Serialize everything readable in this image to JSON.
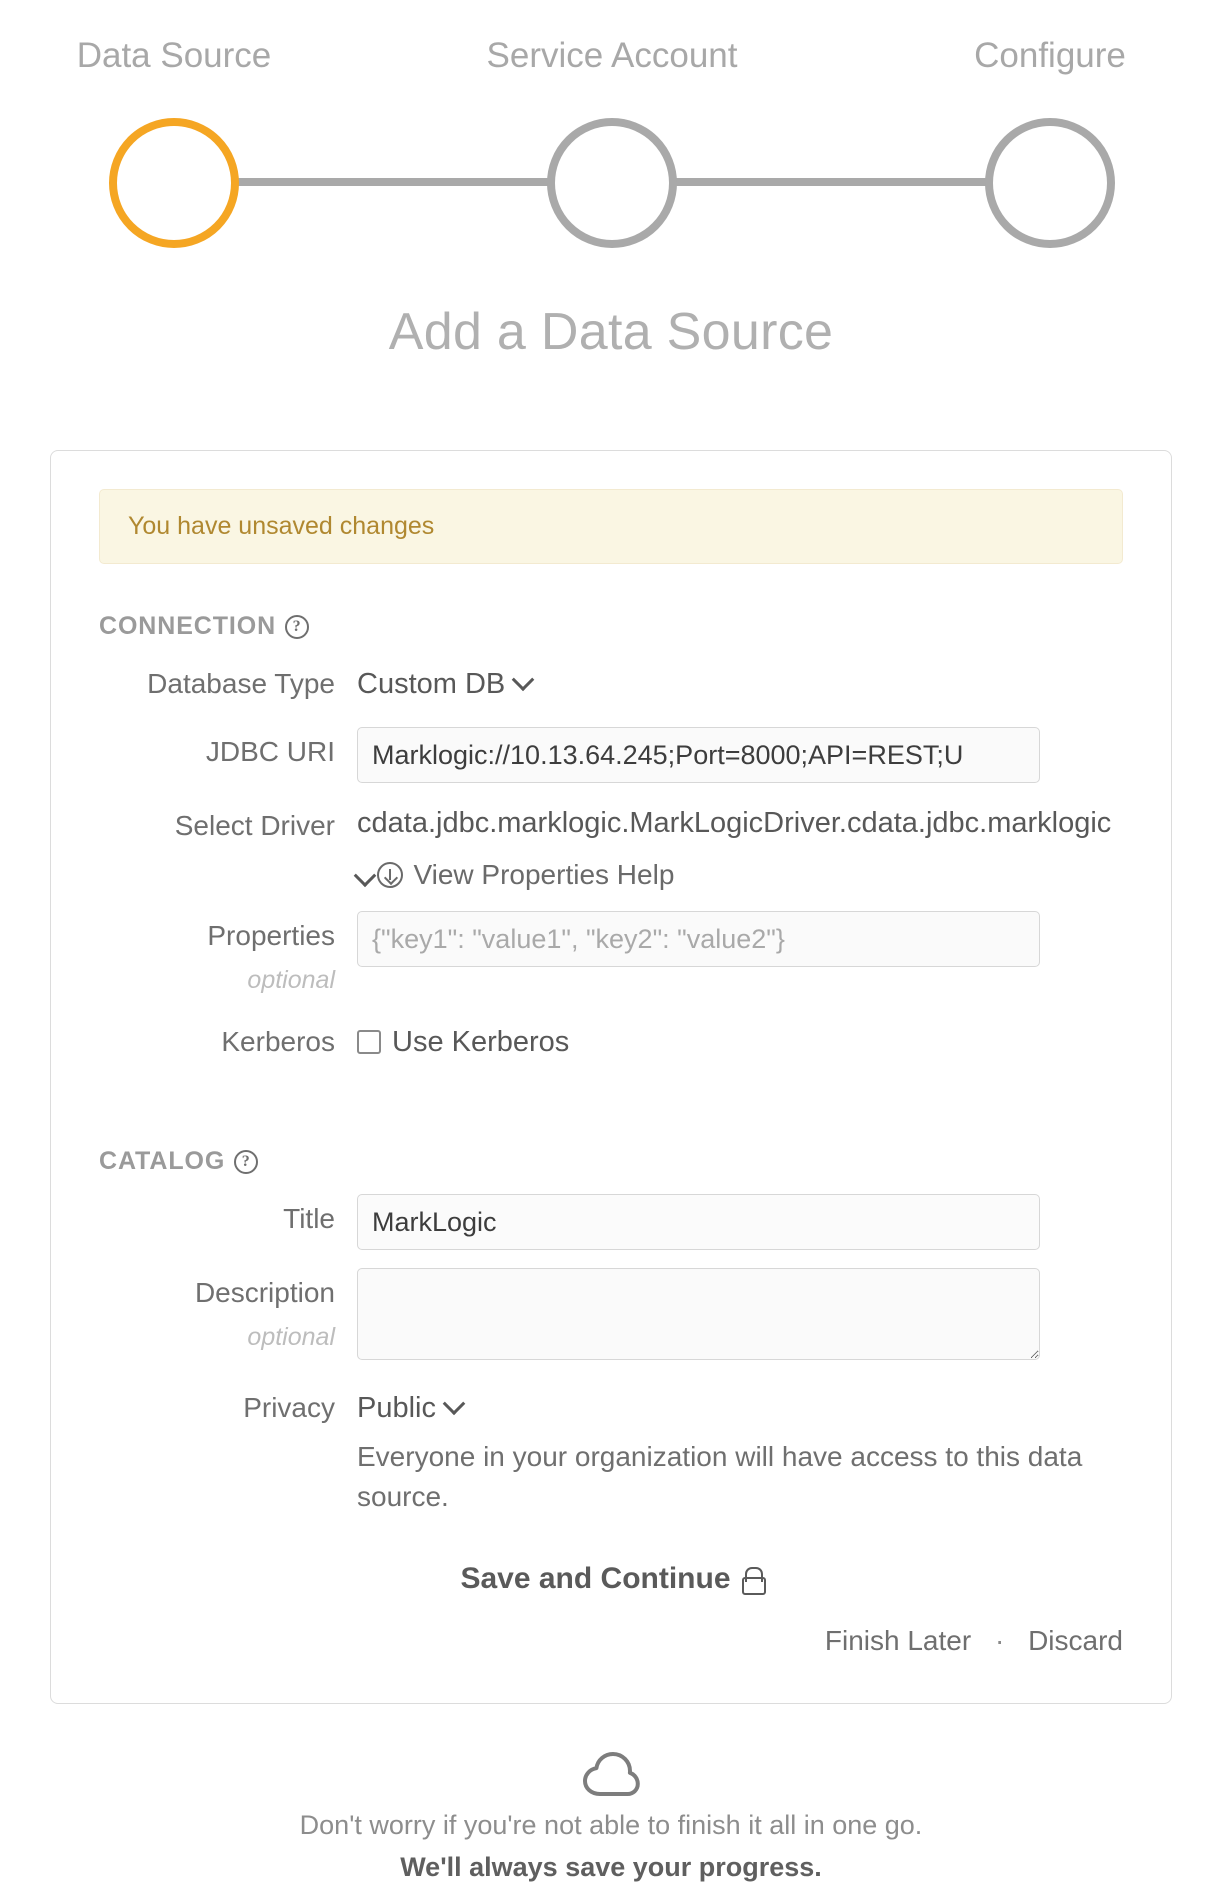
{
  "stepper": {
    "steps": [
      {
        "label": "Data Source",
        "state": "active"
      },
      {
        "label": "Service Account",
        "state": "inactive"
      },
      {
        "label": "Configure",
        "state": "inactive"
      }
    ],
    "active_color": "#f5a623",
    "inactive_color": "#a9a9a9"
  },
  "page_title": "Add a Data Source",
  "alert": {
    "text": "You have unsaved changes",
    "bg": "#faf6e3",
    "fg": "#b08830"
  },
  "connection": {
    "heading": "CONNECTION",
    "help_icon": "question-circle-icon",
    "database_type": {
      "label": "Database Type",
      "value": "Custom DB"
    },
    "jdbc_uri": {
      "label": "JDBC URI",
      "value": "Marklogic://10.13.64.245;Port=8000;API=REST;U",
      "placeholder": ""
    },
    "select_driver": {
      "label": "Select Driver",
      "value": "cdata.jdbc.marklogic.MarkLogicDriver.cdata.jdbc.marklogic"
    },
    "properties_help_link": "View Properties Help",
    "properties": {
      "label": "Properties",
      "sublabel": "optional",
      "value": "",
      "placeholder": "{\"key1\": \"value1\", \"key2\": \"value2\"}"
    },
    "kerberos": {
      "label": "Kerberos",
      "checkbox_label": "Use Kerberos",
      "checked": false
    }
  },
  "catalog": {
    "heading": "CATALOG",
    "help_icon": "question-circle-icon",
    "title": {
      "label": "Title",
      "value": "MarkLogic",
      "placeholder": ""
    },
    "description": {
      "label": "Description",
      "sublabel": "optional",
      "value": "",
      "placeholder": ""
    },
    "privacy": {
      "label": "Privacy",
      "value": "Public",
      "description": "Everyone in your organization will have access to this data source."
    }
  },
  "actions": {
    "save_label": "Save and Continue",
    "save_icon": "lock-icon",
    "finish_later": "Finish Later",
    "separator": "·",
    "discard": "Discard"
  },
  "footer": {
    "icon": "cloud-icon",
    "line1": "Don't worry if you're not able to finish it all in one go.",
    "line2": "We'll always save your progress."
  }
}
